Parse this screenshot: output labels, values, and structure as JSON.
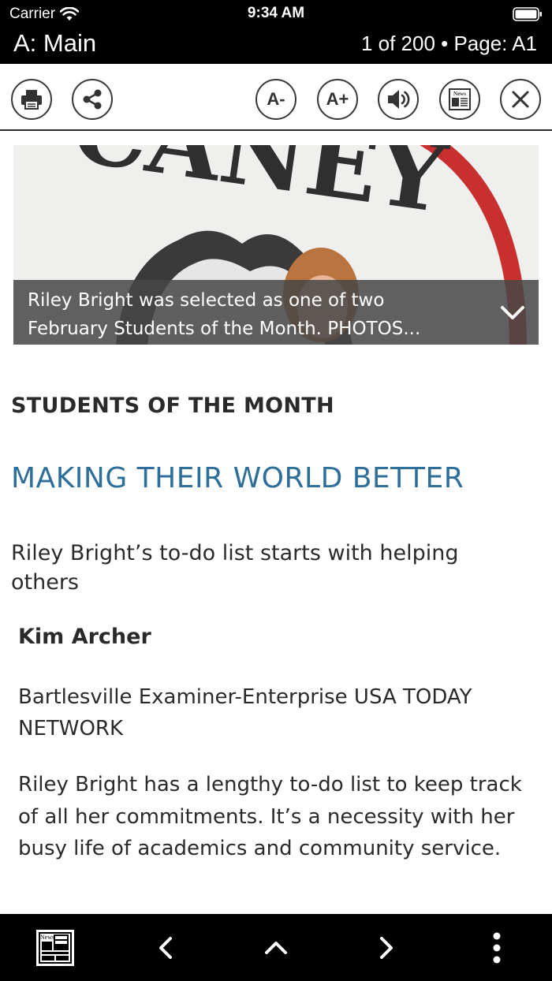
{
  "status_bar": {
    "carrier": "Carrier",
    "time": "9:34 AM"
  },
  "header": {
    "section_title": "A: Main",
    "page_info": "1 of 200 • Page: A1"
  },
  "toolbar": {
    "print_icon": "printer-icon",
    "share_icon": "share-icon",
    "font_decrease_label": "A-",
    "font_increase_label": "A+",
    "audio_icon": "speaker-icon",
    "news_label": "News",
    "close_icon": "close-icon"
  },
  "hero": {
    "image_text": "CANEY",
    "caption": "Riley Bright was selected as one of two\nFebruary Students of the Month. PHOTOS..."
  },
  "article": {
    "kicker": "STUDENTS OF THE MONTH",
    "headline": "MAKING THEIR WORLD BETTER",
    "dek": "Riley Bright’s to-do list starts with helping others",
    "byline": "Kim Archer",
    "credit": "Bartlesville Examiner-Enterprise USA TODAY NETWORK",
    "body": "Riley Bright has a lengthy to-do list to keep track of all her commitments. It’s a necessity with her busy life of academics and community service."
  },
  "bottom_bar": {
    "news_label": "News",
    "icons": [
      "newspaper-icon",
      "chevron-left-icon",
      "chevron-up-icon",
      "chevron-right-icon",
      "more-vertical-icon"
    ]
  },
  "colors": {
    "headline": "#2e6f9a",
    "bars": "#000000"
  }
}
